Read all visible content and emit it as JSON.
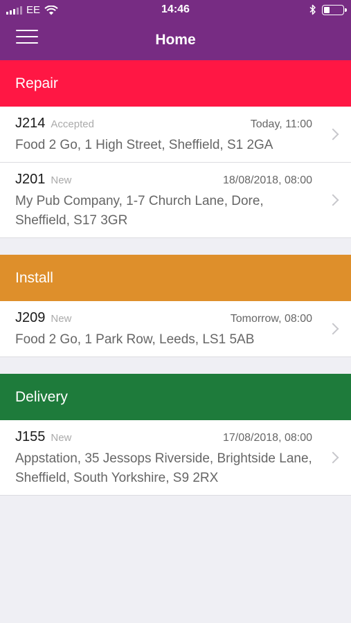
{
  "status_bar": {
    "carrier": "EE",
    "time": "14:46"
  },
  "nav": {
    "title": "Home"
  },
  "colors": {
    "header": "#772c83",
    "repair": "#ff1744",
    "install": "#de8f2b",
    "delivery": "#1e7b3b"
  },
  "sections": [
    {
      "title": "Repair",
      "jobs": [
        {
          "id": "J214",
          "status": "Accepted",
          "time": "Today, 11:00",
          "address": "Food 2 Go, 1 High Street, Sheffield, S1 2GA"
        },
        {
          "id": "J201",
          "status": "New",
          "time": "18/08/2018, 08:00",
          "address": "My Pub Company, 1-7 Church Lane, Dore, Sheffield, S17 3GR"
        }
      ]
    },
    {
      "title": "Install",
      "jobs": [
        {
          "id": "J209",
          "status": "New",
          "time": "Tomorrow, 08:00",
          "address": "Food 2 Go, 1 Park Row, Leeds, LS1 5AB"
        }
      ]
    },
    {
      "title": "Delivery",
      "jobs": [
        {
          "id": "J155",
          "status": "New",
          "time": "17/08/2018, 08:00",
          "address": "Appstation, 35 Jessops Riverside, Brightside Lane, Sheffield, South Yorkshire, S9 2RX"
        }
      ]
    }
  ]
}
